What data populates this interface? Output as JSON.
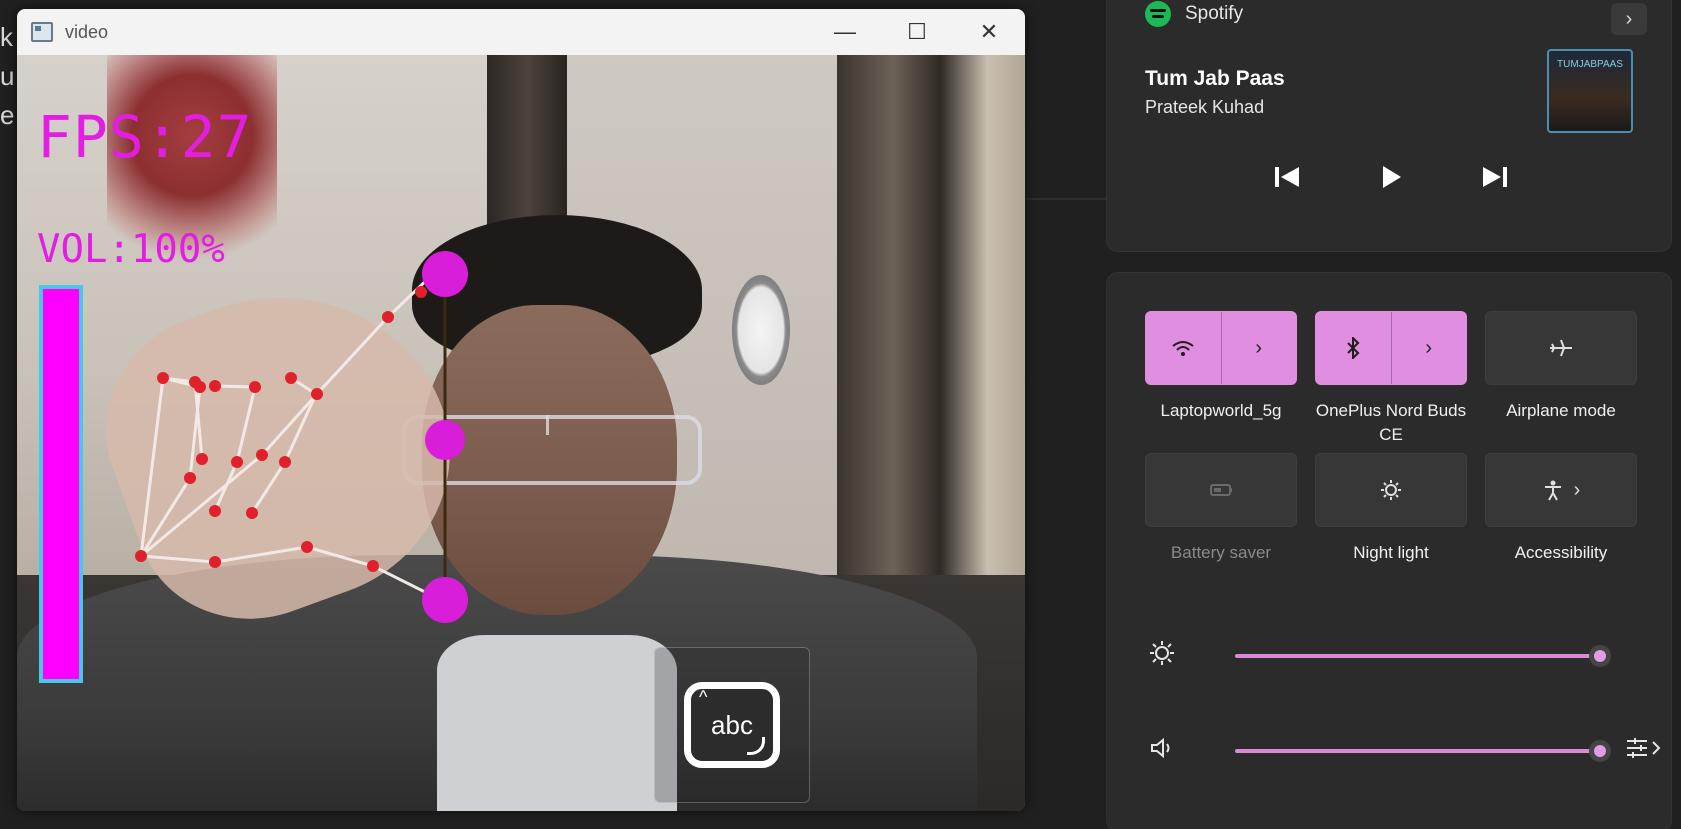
{
  "background": {
    "left_letters": [
      "k",
      "u",
      "e"
    ]
  },
  "video_window": {
    "title": "video",
    "controls": {
      "minimize": "—",
      "maximize": "☐",
      "close": "✕"
    },
    "overlay": {
      "fps_text": "FPS:27",
      "vol_text": "VOL:100%",
      "volume_level": 1.0,
      "colors": {
        "magenta": "#e31de3",
        "bar_fill": "#ff00ff",
        "bar_border": "#46c8e6",
        "landmark": "#e0202a"
      }
    },
    "touch_keyboard_icon": {
      "label": "abc"
    }
  },
  "media": {
    "app": "Spotify",
    "track_title": "Tum Jab Paas",
    "artist": "Prateek Kuhad",
    "album_art_text": "TUMJABPAAS",
    "controls": [
      "previous-icon",
      "play-icon",
      "next-icon"
    ]
  },
  "quick_settings": {
    "tiles": [
      {
        "label": "Laptopworld_5g",
        "icon": "wifi-icon",
        "active": true,
        "has_chevron": true
      },
      {
        "label": "OnePlus Nord Buds CE",
        "icon": "bluetooth-icon",
        "active": true,
        "has_chevron": true
      },
      {
        "label": "Airplane mode",
        "icon": "airplane-icon",
        "active": false,
        "has_chevron": false
      },
      {
        "label": "Battery saver",
        "icon": "battery-icon",
        "active": false,
        "disabled": true
      },
      {
        "label": "Night light",
        "icon": "night-light-icon",
        "active": false
      },
      {
        "label": "Accessibility",
        "icon": "accessibility-icon",
        "active": false,
        "has_chevron": true
      }
    ],
    "brightness": 1.0,
    "volume": 1.0,
    "accent_color": "#df8ee0"
  }
}
